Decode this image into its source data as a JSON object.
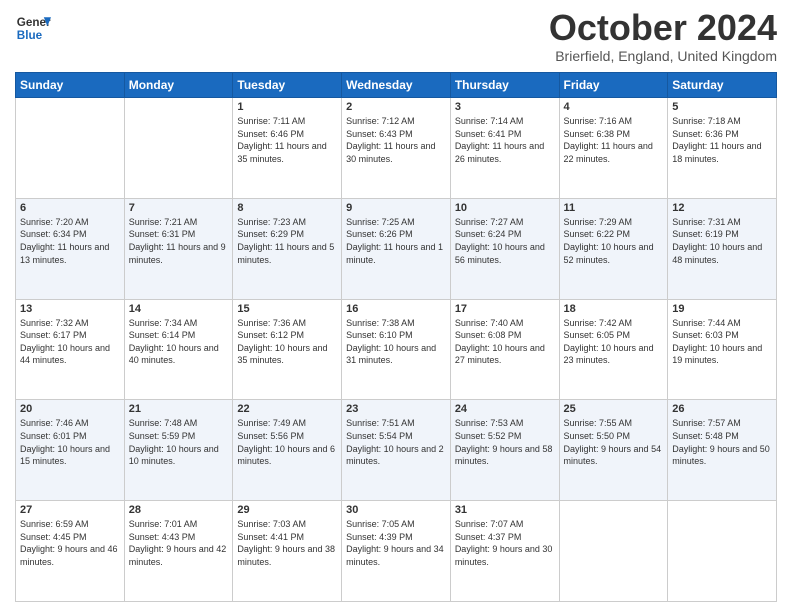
{
  "header": {
    "logo_line1": "General",
    "logo_line2": "Blue",
    "month": "October 2024",
    "location": "Brierfield, England, United Kingdom"
  },
  "days_of_week": [
    "Sunday",
    "Monday",
    "Tuesday",
    "Wednesday",
    "Thursday",
    "Friday",
    "Saturday"
  ],
  "weeks": [
    [
      {
        "day": "",
        "sunrise": "",
        "sunset": "",
        "daylight": ""
      },
      {
        "day": "",
        "sunrise": "",
        "sunset": "",
        "daylight": ""
      },
      {
        "day": "1",
        "sunrise": "Sunrise: 7:11 AM",
        "sunset": "Sunset: 6:46 PM",
        "daylight": "Daylight: 11 hours and 35 minutes."
      },
      {
        "day": "2",
        "sunrise": "Sunrise: 7:12 AM",
        "sunset": "Sunset: 6:43 PM",
        "daylight": "Daylight: 11 hours and 30 minutes."
      },
      {
        "day": "3",
        "sunrise": "Sunrise: 7:14 AM",
        "sunset": "Sunset: 6:41 PM",
        "daylight": "Daylight: 11 hours and 26 minutes."
      },
      {
        "day": "4",
        "sunrise": "Sunrise: 7:16 AM",
        "sunset": "Sunset: 6:38 PM",
        "daylight": "Daylight: 11 hours and 22 minutes."
      },
      {
        "day": "5",
        "sunrise": "Sunrise: 7:18 AM",
        "sunset": "Sunset: 6:36 PM",
        "daylight": "Daylight: 11 hours and 18 minutes."
      }
    ],
    [
      {
        "day": "6",
        "sunrise": "Sunrise: 7:20 AM",
        "sunset": "Sunset: 6:34 PM",
        "daylight": "Daylight: 11 hours and 13 minutes."
      },
      {
        "day": "7",
        "sunrise": "Sunrise: 7:21 AM",
        "sunset": "Sunset: 6:31 PM",
        "daylight": "Daylight: 11 hours and 9 minutes."
      },
      {
        "day": "8",
        "sunrise": "Sunrise: 7:23 AM",
        "sunset": "Sunset: 6:29 PM",
        "daylight": "Daylight: 11 hours and 5 minutes."
      },
      {
        "day": "9",
        "sunrise": "Sunrise: 7:25 AM",
        "sunset": "Sunset: 6:26 PM",
        "daylight": "Daylight: 11 hours and 1 minute."
      },
      {
        "day": "10",
        "sunrise": "Sunrise: 7:27 AM",
        "sunset": "Sunset: 6:24 PM",
        "daylight": "Daylight: 10 hours and 56 minutes."
      },
      {
        "day": "11",
        "sunrise": "Sunrise: 7:29 AM",
        "sunset": "Sunset: 6:22 PM",
        "daylight": "Daylight: 10 hours and 52 minutes."
      },
      {
        "day": "12",
        "sunrise": "Sunrise: 7:31 AM",
        "sunset": "Sunset: 6:19 PM",
        "daylight": "Daylight: 10 hours and 48 minutes."
      }
    ],
    [
      {
        "day": "13",
        "sunrise": "Sunrise: 7:32 AM",
        "sunset": "Sunset: 6:17 PM",
        "daylight": "Daylight: 10 hours and 44 minutes."
      },
      {
        "day": "14",
        "sunrise": "Sunrise: 7:34 AM",
        "sunset": "Sunset: 6:14 PM",
        "daylight": "Daylight: 10 hours and 40 minutes."
      },
      {
        "day": "15",
        "sunrise": "Sunrise: 7:36 AM",
        "sunset": "Sunset: 6:12 PM",
        "daylight": "Daylight: 10 hours and 35 minutes."
      },
      {
        "day": "16",
        "sunrise": "Sunrise: 7:38 AM",
        "sunset": "Sunset: 6:10 PM",
        "daylight": "Daylight: 10 hours and 31 minutes."
      },
      {
        "day": "17",
        "sunrise": "Sunrise: 7:40 AM",
        "sunset": "Sunset: 6:08 PM",
        "daylight": "Daylight: 10 hours and 27 minutes."
      },
      {
        "day": "18",
        "sunrise": "Sunrise: 7:42 AM",
        "sunset": "Sunset: 6:05 PM",
        "daylight": "Daylight: 10 hours and 23 minutes."
      },
      {
        "day": "19",
        "sunrise": "Sunrise: 7:44 AM",
        "sunset": "Sunset: 6:03 PM",
        "daylight": "Daylight: 10 hours and 19 minutes."
      }
    ],
    [
      {
        "day": "20",
        "sunrise": "Sunrise: 7:46 AM",
        "sunset": "Sunset: 6:01 PM",
        "daylight": "Daylight: 10 hours and 15 minutes."
      },
      {
        "day": "21",
        "sunrise": "Sunrise: 7:48 AM",
        "sunset": "Sunset: 5:59 PM",
        "daylight": "Daylight: 10 hours and 10 minutes."
      },
      {
        "day": "22",
        "sunrise": "Sunrise: 7:49 AM",
        "sunset": "Sunset: 5:56 PM",
        "daylight": "Daylight: 10 hours and 6 minutes."
      },
      {
        "day": "23",
        "sunrise": "Sunrise: 7:51 AM",
        "sunset": "Sunset: 5:54 PM",
        "daylight": "Daylight: 10 hours and 2 minutes."
      },
      {
        "day": "24",
        "sunrise": "Sunrise: 7:53 AM",
        "sunset": "Sunset: 5:52 PM",
        "daylight": "Daylight: 9 hours and 58 minutes."
      },
      {
        "day": "25",
        "sunrise": "Sunrise: 7:55 AM",
        "sunset": "Sunset: 5:50 PM",
        "daylight": "Daylight: 9 hours and 54 minutes."
      },
      {
        "day": "26",
        "sunrise": "Sunrise: 7:57 AM",
        "sunset": "Sunset: 5:48 PM",
        "daylight": "Daylight: 9 hours and 50 minutes."
      }
    ],
    [
      {
        "day": "27",
        "sunrise": "Sunrise: 6:59 AM",
        "sunset": "Sunset: 4:45 PM",
        "daylight": "Daylight: 9 hours and 46 minutes."
      },
      {
        "day": "28",
        "sunrise": "Sunrise: 7:01 AM",
        "sunset": "Sunset: 4:43 PM",
        "daylight": "Daylight: 9 hours and 42 minutes."
      },
      {
        "day": "29",
        "sunrise": "Sunrise: 7:03 AM",
        "sunset": "Sunset: 4:41 PM",
        "daylight": "Daylight: 9 hours and 38 minutes."
      },
      {
        "day": "30",
        "sunrise": "Sunrise: 7:05 AM",
        "sunset": "Sunset: 4:39 PM",
        "daylight": "Daylight: 9 hours and 34 minutes."
      },
      {
        "day": "31",
        "sunrise": "Sunrise: 7:07 AM",
        "sunset": "Sunset: 4:37 PM",
        "daylight": "Daylight: 9 hours and 30 minutes."
      },
      {
        "day": "",
        "sunrise": "",
        "sunset": "",
        "daylight": ""
      },
      {
        "day": "",
        "sunrise": "",
        "sunset": "",
        "daylight": ""
      }
    ]
  ]
}
